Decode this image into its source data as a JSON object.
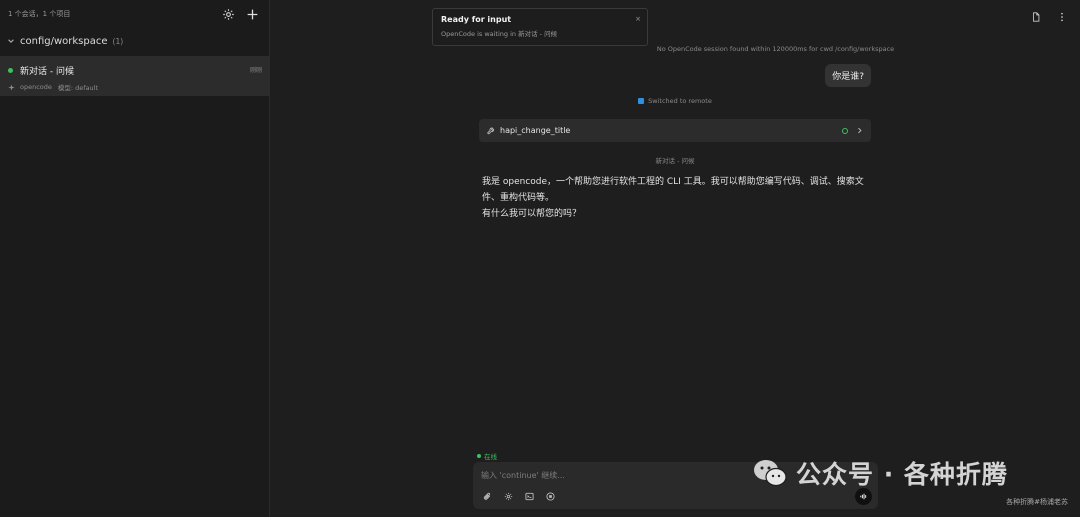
{
  "sidebar": {
    "summary": "1 个会话，1 个项目",
    "workspace": {
      "name": "config/workspace",
      "count": "(1)"
    },
    "sessions": [
      {
        "title": "新对话 - 问候",
        "time": "刚刚",
        "agent": "opencode",
        "model": "模型: default",
        "status_color": "#3fbf5f"
      }
    ]
  },
  "toast": {
    "title": "Ready for input",
    "message": "OpenCode is waiting in 新对话 - 问候",
    "close": "×"
  },
  "notice": "No OpenCode session found within 120000ms for cwd /config/workspace",
  "conversation": {
    "user_message": "你是谁?",
    "switched": "Switched to remote",
    "tool_call": {
      "name": "hapi_change_title"
    },
    "session_label": "新对话 - 问候",
    "reply_lines": [
      "我是 opencode，一个帮助您进行软件工程的 CLI 工具。我可以帮助您编写代码、调试、搜索文",
      "件、重构代码等。",
      "有什么我可以帮您的吗？"
    ]
  },
  "composer": {
    "status": "在线",
    "placeholder": "输入 'continue' 继续..."
  },
  "watermark": {
    "title": "公众号 · 各种折腾",
    "subtitle": "各种折腾#杨浦老苏"
  },
  "icons": {
    "settings": "gear-icon",
    "new": "plus-icon",
    "file": "file-icon",
    "more": "more-vertical-icon",
    "attach": "paperclip-icon",
    "terminal": "terminal-icon",
    "stop": "stop-icon",
    "send": "voice-icon"
  },
  "colors": {
    "accent_green": "#3fbf5f",
    "checkbox_blue": "#2f8fe0",
    "background": "#1e1e1e",
    "sidebar": "#1b1b1b"
  }
}
